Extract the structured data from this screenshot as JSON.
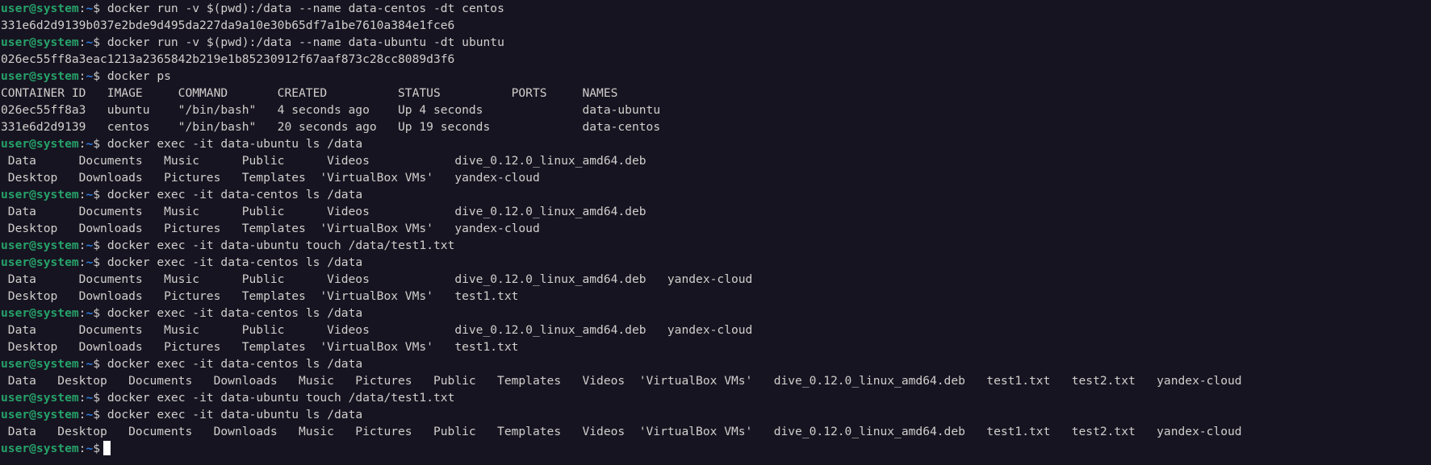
{
  "terminal": {
    "background": "#171421",
    "prompt_color": "#26a269",
    "path_color": "#2a7bde",
    "prompt": {
      "user": "user@system",
      "colon": ":",
      "path": "~",
      "symbol": "$"
    },
    "lines": [
      {
        "type": "cmd",
        "text": "docker run -v $(pwd):/data --name data-centos -dt centos"
      },
      {
        "type": "out",
        "text": "331e6d2d9139b037e2bde9d495da227da9a10e30b65df7a1be7610a384e1fce6"
      },
      {
        "type": "cmd",
        "text": "docker run -v $(pwd):/data --name data-ubuntu -dt ubuntu"
      },
      {
        "type": "out",
        "text": "026ec55ff8a3eac1213a2365842b219e1b85230912f67aaf873c28cc8089d3f6"
      },
      {
        "type": "cmd",
        "text": "docker ps"
      },
      {
        "type": "out",
        "text": "CONTAINER ID   IMAGE     COMMAND       CREATED          STATUS          PORTS     NAMES"
      },
      {
        "type": "out",
        "text": "026ec55ff8a3   ubuntu    \"/bin/bash\"   4 seconds ago    Up 4 seconds              data-ubuntu"
      },
      {
        "type": "out",
        "text": "331e6d2d9139   centos    \"/bin/bash\"   20 seconds ago   Up 19 seconds             data-centos"
      },
      {
        "type": "cmd",
        "text": "docker exec -it data-ubuntu ls /data"
      },
      {
        "type": "out",
        "text": " Data      Documents   Music      Public      Videos            dive_0.12.0_linux_amd64.deb"
      },
      {
        "type": "out",
        "text": " Desktop   Downloads   Pictures   Templates  'VirtualBox VMs'   yandex-cloud"
      },
      {
        "type": "cmd",
        "text": "docker exec -it data-centos ls /data"
      },
      {
        "type": "out",
        "text": " Data      Documents   Music      Public      Videos            dive_0.12.0_linux_amd64.deb"
      },
      {
        "type": "out",
        "text": " Desktop   Downloads   Pictures   Templates  'VirtualBox VMs'   yandex-cloud"
      },
      {
        "type": "cmd",
        "text": "docker exec -it data-ubuntu touch /data/test1.txt"
      },
      {
        "type": "cmd",
        "text": "docker exec -it data-centos ls /data"
      },
      {
        "type": "out",
        "text": " Data      Documents   Music      Public      Videos            dive_0.12.0_linux_amd64.deb   yandex-cloud"
      },
      {
        "type": "out",
        "text": " Desktop   Downloads   Pictures   Templates  'VirtualBox VMs'   test1.txt"
      },
      {
        "type": "cmd",
        "text": "docker exec -it data-centos ls /data"
      },
      {
        "type": "out",
        "text": " Data      Documents   Music      Public      Videos            dive_0.12.0_linux_amd64.deb   yandex-cloud"
      },
      {
        "type": "out",
        "text": " Desktop   Downloads   Pictures   Templates  'VirtualBox VMs'   test1.txt"
      },
      {
        "type": "cmd",
        "text": "docker exec -it data-centos ls /data"
      },
      {
        "type": "out",
        "text": " Data   Desktop   Documents   Downloads   Music   Pictures   Public   Templates   Videos  'VirtualBox VMs'   dive_0.12.0_linux_amd64.deb   test1.txt   test2.txt   yandex-cloud"
      },
      {
        "type": "cmd",
        "text": "docker exec -it data-ubuntu touch /data/test1.txt"
      },
      {
        "type": "cmd",
        "text": "docker exec -it data-ubuntu ls /data"
      },
      {
        "type": "out",
        "text": " Data   Desktop   Documents   Downloads   Music   Pictures   Public   Templates   Videos  'VirtualBox VMs'   dive_0.12.0_linux_amd64.deb   test1.txt   test2.txt   yandex-cloud"
      },
      {
        "type": "cursor",
        "text": ""
      }
    ]
  }
}
